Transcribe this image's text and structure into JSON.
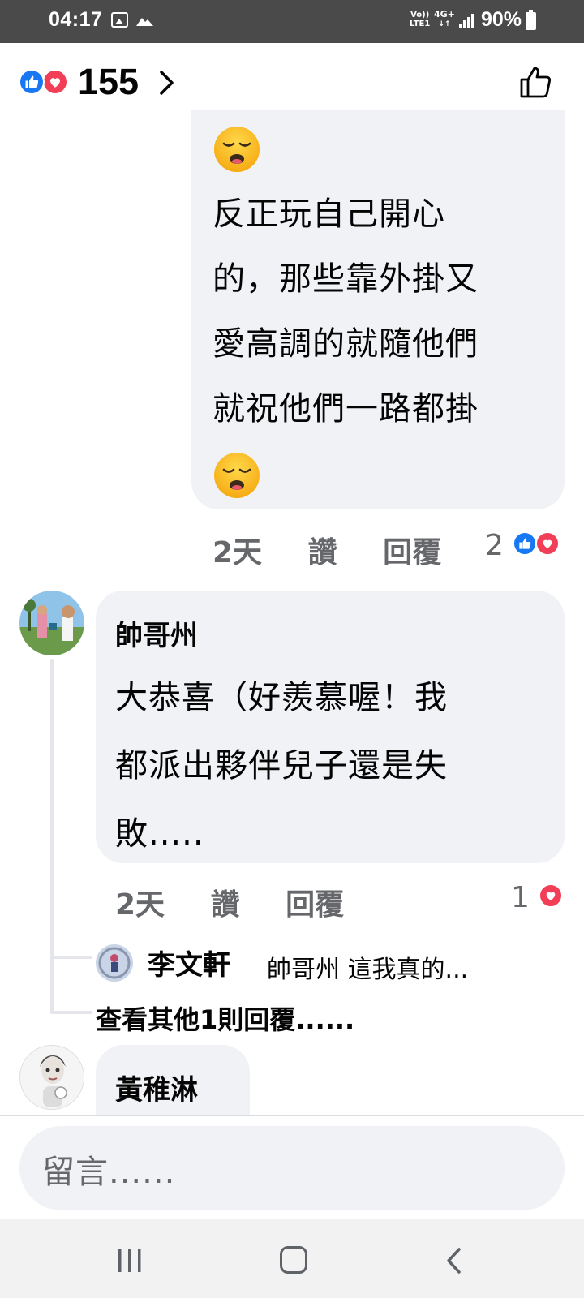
{
  "status_bar": {
    "time": "04:17",
    "volte_top": "Vo))",
    "volte_bottom": "LTE1",
    "network_top": "4G+",
    "network_bottom": "↓↑",
    "battery": "90%",
    "icons": [
      "image-icon",
      "cloud-icon",
      "signal-icon",
      "battery-icon"
    ]
  },
  "header": {
    "reaction_count": "155",
    "icons": [
      "like-reaction-icon",
      "love-reaction-icon",
      "chevron-right-icon",
      "thumbs-up-icon"
    ]
  },
  "comments": [
    {
      "text_lines": [
        "反正玩自己開心",
        "的，那些靠外掛又",
        "愛高調的就隨他們",
        "就祝他們一路都掛"
      ],
      "emoji": "relieved-face-emoji",
      "time": "2天",
      "like_label": "讚",
      "reply_label": "回覆",
      "reaction_count": "2"
    },
    {
      "author": "帥哥州",
      "text_lines": [
        "大恭喜（好羨慕喔！我",
        "都派出夥伴兒子還是失",
        "敗....."
      ],
      "time": "2天",
      "like_label": "讚",
      "reply_label": "回覆",
      "reaction_count": "1",
      "reply_preview": {
        "author": "李文軒",
        "text": "帥哥州 這我真的..."
      },
      "more_replies_label": "查看其他1則回覆......"
    },
    {
      "author": "黃稚淋"
    }
  ],
  "composer": {
    "placeholder": "留言......"
  },
  "colors": {
    "facebook_blue": "#1877f2",
    "love_red": "#f33e58",
    "bubble_gray": "#f0f2f5",
    "secondary_text": "#65676b"
  }
}
